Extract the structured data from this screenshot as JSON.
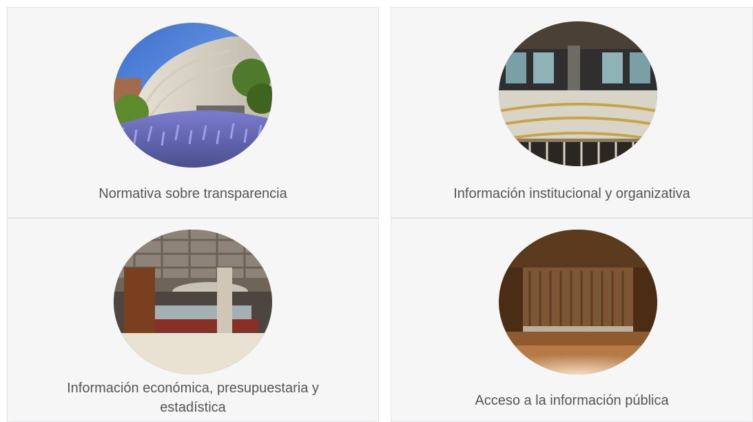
{
  "cards": [
    {
      "title": "Normativa sobre transparencia",
      "image": "building-exterior-lavender-photo"
    },
    {
      "title": "Información institucional y organizativa",
      "image": "atrium-balcony-railings-photo"
    },
    {
      "title": "Información económica, presupuestaria y estadística",
      "image": "lobby-coffered-ceiling-photo"
    },
    {
      "title": "Acceso a la información pública",
      "image": "auditorium-stage-curtain-photo"
    }
  ]
}
